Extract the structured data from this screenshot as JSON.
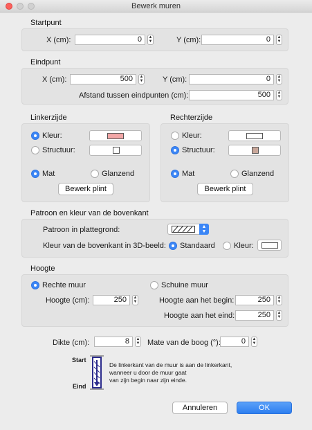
{
  "window": {
    "title": "Bewerk muren"
  },
  "startpoint": {
    "title": "Startpunt",
    "x_label": "X (cm):",
    "x_value": "0",
    "y_label": "Y (cm):",
    "y_value": "0"
  },
  "endpoint": {
    "title": "Eindpunt",
    "x_label": "X (cm):",
    "x_value": "500",
    "y_label": "Y (cm):",
    "y_value": "0",
    "distance_label": "Afstand tussen eindpunten (cm):",
    "distance_value": "500"
  },
  "left_side": {
    "title": "Linkerzijde",
    "color_label": "Kleur:",
    "texture_label": "Structuur:",
    "matt_label": "Mat",
    "glossy_label": "Glanzend",
    "baseboard_button": "Bewerk plint",
    "selected_fill": "color",
    "selected_finish": "matt",
    "color_swatch": "#f2a6a6"
  },
  "right_side": {
    "title": "Rechterzijde",
    "color_label": "Kleur:",
    "texture_label": "Structuur:",
    "matt_label": "Mat",
    "glossy_label": "Glanzend",
    "baseboard_button": "Bewerk plint",
    "selected_fill": "texture",
    "selected_finish": "matt",
    "texture_swatch": "#c9a79a"
  },
  "pattern": {
    "title": "Patroon en kleur van de bovenkant",
    "plan_pattern_label": "Patroon in plattegrond:",
    "top_color_label": "Kleur van de bovenkant in 3D-beeld:",
    "default_label": "Standaard",
    "color_label": "Kleur:",
    "selected": "default"
  },
  "height": {
    "title": "Hoogte",
    "straight_label": "Rechte muur",
    "sloping_label": "Schuine muur",
    "selected": "straight",
    "height_label": "Hoogte (cm):",
    "height_value": "250",
    "start_label": "Hoogte aan het begin:",
    "start_value": "250",
    "end_label": "Hoogte aan het eind:",
    "end_value": "250"
  },
  "thickness": {
    "label": "Dikte (cm):",
    "value": "8"
  },
  "arc": {
    "label": "Mate van de boog (°):",
    "value": "0"
  },
  "diagram": {
    "start_label": "Start",
    "end_label": "Eind",
    "text": [
      "De linkerkant van de muur is aan de linkerkant,",
      "wanneer u door de muur gaat",
      "van zijn begin naar zijn einde."
    ]
  },
  "buttons": {
    "cancel": "Annuleren",
    "ok": "OK"
  },
  "colors": {
    "accent": "#3b86f6"
  }
}
